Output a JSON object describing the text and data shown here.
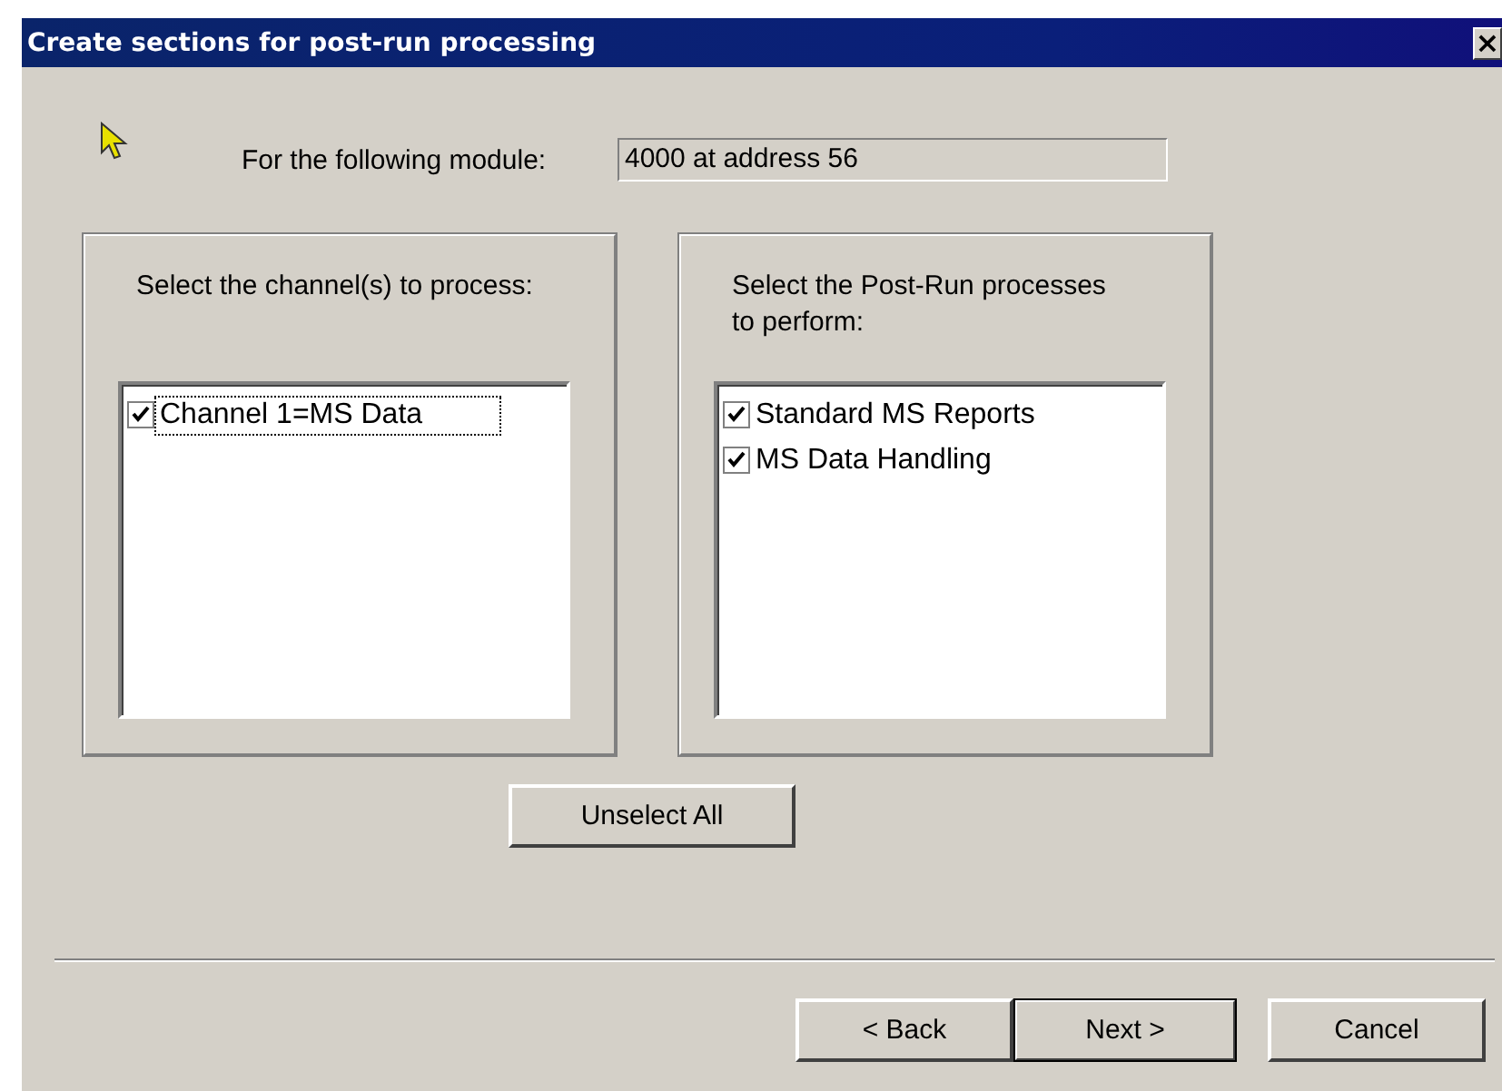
{
  "window": {
    "title": "Create sections for post-run processing",
    "close_glyph": "×"
  },
  "module": {
    "label": "For the following module:",
    "value": "4000 at address 56"
  },
  "groups": [
    {
      "prompt": "Select the channel(s) to process:",
      "items": [
        {
          "label": "Channel 1=MS Data",
          "checked": true,
          "focused": true
        }
      ]
    },
    {
      "prompt": "Select the Post-Run processes to perform:",
      "items": [
        {
          "label": "Standard MS Reports",
          "checked": true,
          "focused": false
        },
        {
          "label": "MS Data Handling",
          "checked": true,
          "focused": false
        }
      ]
    }
  ],
  "unselect_button": "Unselect All",
  "buttons": [
    {
      "label": "< Back",
      "default": false
    },
    {
      "label": "Next >",
      "default": true
    },
    {
      "label": "Cancel",
      "default": false
    }
  ]
}
